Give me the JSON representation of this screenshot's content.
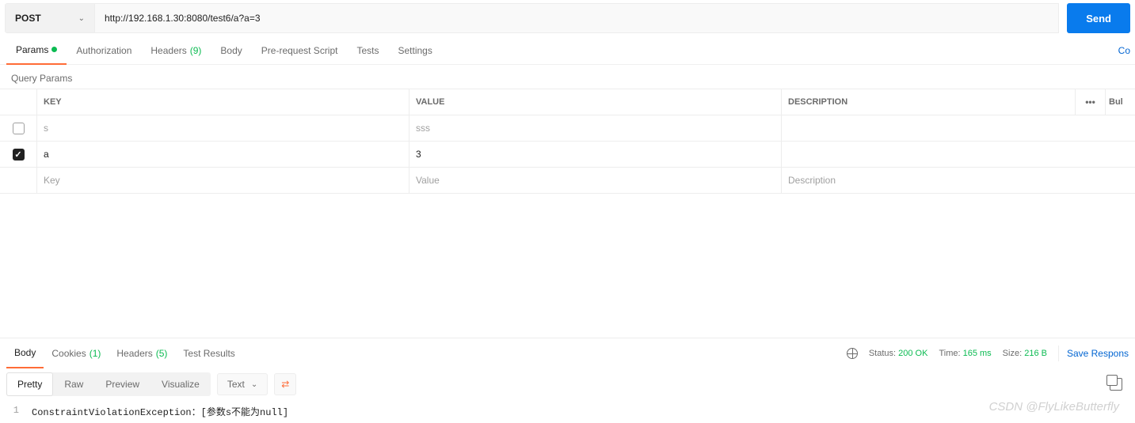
{
  "request": {
    "method": "POST",
    "url": "http://192.168.1.30:8080/test6/a?a=3",
    "send_label": "Send"
  },
  "tabs": {
    "params": "Params",
    "auth": "Authorization",
    "headers": "Headers",
    "headers_count": "(9)",
    "body": "Body",
    "prerequest": "Pre-request Script",
    "tests": "Tests",
    "settings": "Settings",
    "code": "Co"
  },
  "params_section": {
    "title": "Query Params",
    "headers": {
      "key": "KEY",
      "value": "VALUE",
      "description": "DESCRIPTION",
      "bulk": "Bul"
    },
    "rows": [
      {
        "checked": false,
        "key": "s",
        "value": "sss",
        "desc": ""
      },
      {
        "checked": true,
        "key": "a",
        "value": "3",
        "desc": ""
      }
    ],
    "placeholder": {
      "key": "Key",
      "value": "Value",
      "desc": "Description"
    }
  },
  "response": {
    "tabs": {
      "body": "Body",
      "cookies": "Cookies",
      "cookies_count": "(1)",
      "headers": "Headers",
      "headers_count": "(5)",
      "test_results": "Test Results"
    },
    "status": {
      "label_status": "Status:",
      "value_status": "200 OK",
      "label_time": "Time:",
      "value_time": "165 ms",
      "label_size": "Size:",
      "value_size": "216 B",
      "save": "Save Respons"
    },
    "view": {
      "pretty": "Pretty",
      "raw": "Raw",
      "preview": "Preview",
      "visualize": "Visualize",
      "format": "Text"
    },
    "body_lines": [
      {
        "num": "1",
        "text": "ConstraintViolationException：[参数s不能为null]"
      }
    ]
  },
  "watermark": "CSDN @FlyLikeButterfly"
}
